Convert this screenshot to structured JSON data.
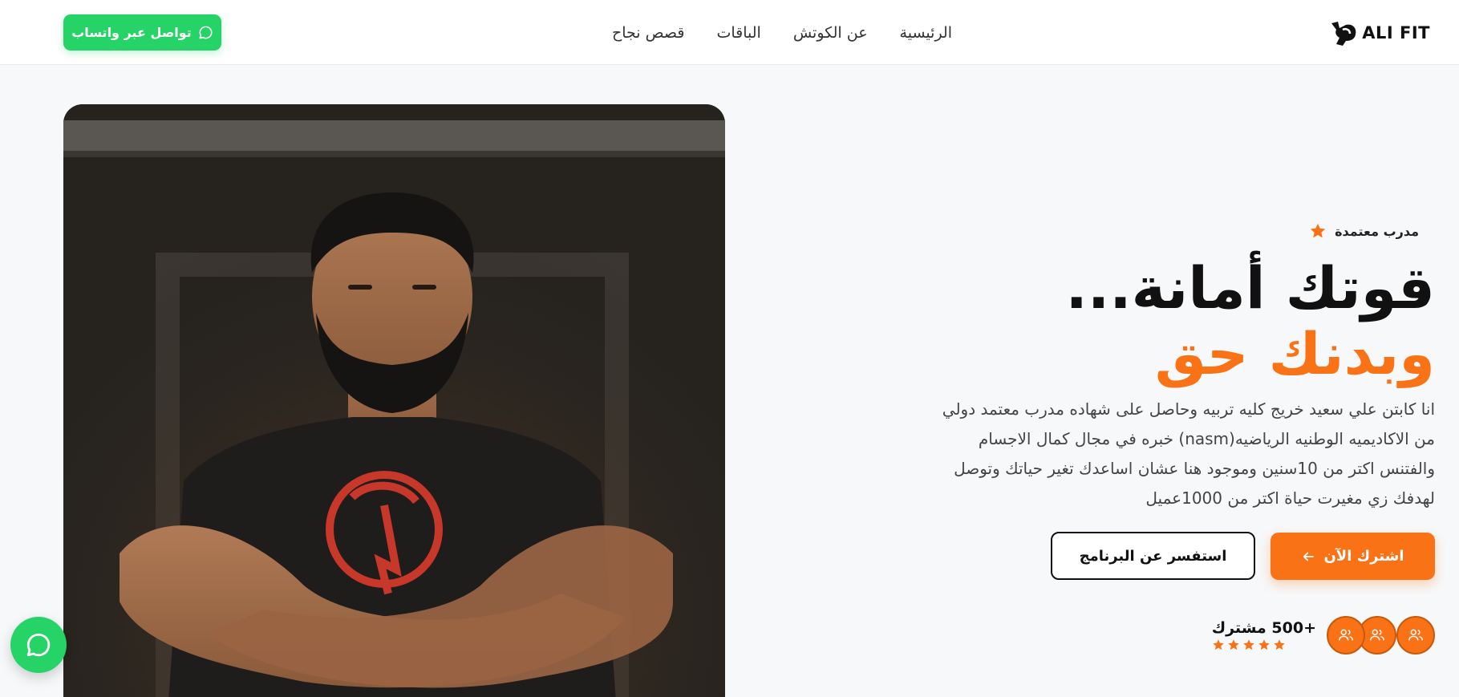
{
  "brand": {
    "logo_text": "ALI FIT"
  },
  "nav": {
    "items": [
      {
        "label": "الرئيسية"
      },
      {
        "label": "عن الكوتش"
      },
      {
        "label": "الباقات"
      },
      {
        "label": "قصص نجاح"
      }
    ]
  },
  "header_cta": {
    "label": "تواصل عبر واتساب",
    "icon": "whatsapp-icon"
  },
  "hero": {
    "badge": "مدرب معتمدة",
    "title_line1": "قوتك أمانة...",
    "title_line2": "وبدنك حق",
    "description": "انا كابتن علي سعيد خريج كليه تربيه وحاصل على شهاده مدرب معتمد دولي من الاكاديميه الوطنيه الرياضيه(nasm) خبره في مجال كمال الاجسام والفتنس اكتر من 10سنين وموجود هنا عشان اساعدك تغير حياتك وتوصل لهدفك زي مغيرت حياة اكتر من 1000عميل",
    "primary_button": "اشترك الآن",
    "secondary_button": "استفسر عن البرنامج",
    "subscribers": "+500 مشترك",
    "rating_stars": 5
  },
  "colors": {
    "accent": "#f97316",
    "whatsapp": "#25d366",
    "text": "#111111"
  }
}
